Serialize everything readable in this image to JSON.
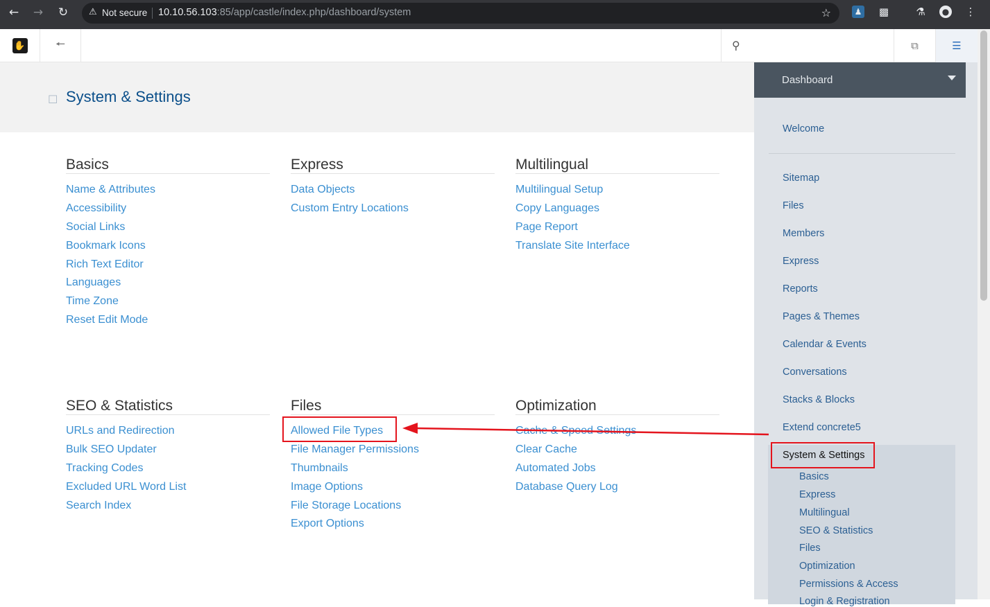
{
  "browser": {
    "security_label": "Not secure",
    "url_host": "10.10.56.103",
    "url_rest": ":85/app/castle/index.php/dashboard/system"
  },
  "toolbar": {
    "search_placeholder": ""
  },
  "page": {
    "title": "System & Settings"
  },
  "sections": [
    {
      "title": "Basics",
      "links": [
        "Name & Attributes",
        "Accessibility",
        "Social Links",
        "Bookmark Icons",
        "Rich Text Editor",
        "Languages",
        "Time Zone",
        "Reset Edit Mode"
      ]
    },
    {
      "title": "Express",
      "links": [
        "Data Objects",
        "Custom Entry Locations"
      ]
    },
    {
      "title": "Multilingual",
      "links": [
        "Multilingual Setup",
        "Copy Languages",
        "Page Report",
        "Translate Site Interface"
      ]
    },
    {
      "title": "SEO & Statistics",
      "links": [
        "URLs and Redirection",
        "Bulk SEO Updater",
        "Tracking Codes",
        "Excluded URL Word List",
        "Search Index"
      ]
    },
    {
      "title": "Files",
      "links": [
        "Allowed File Types",
        "File Manager Permissions",
        "Thumbnails",
        "Image Options",
        "File Storage Locations",
        "Export Options"
      ]
    },
    {
      "title": "Optimization",
      "links": [
        "Cache & Speed Settings",
        "Clear Cache",
        "Automated Jobs",
        "Database Query Log"
      ]
    }
  ],
  "panel": {
    "title": "Dashboard",
    "welcome": "Welcome",
    "items": [
      "Sitemap",
      "Files",
      "Members",
      "Express",
      "Reports",
      "Pages & Themes",
      "Calendar & Events",
      "Conversations",
      "Stacks & Blocks",
      "Extend concrete5",
      "System & Settings"
    ],
    "subitems": [
      "Basics",
      "Express",
      "Multilingual",
      "SEO & Statistics",
      "Files",
      "Optimization",
      "Permissions & Access",
      "Login & Registration"
    ]
  },
  "colors": {
    "link": "#3a8fd1",
    "title": "#0b4f8a",
    "highlight": "#e4141d",
    "panel_bg": "#dfe3e8",
    "panel_head": "#4a5560"
  },
  "icons": [
    "back-icon",
    "forward-icon",
    "reload-icon",
    "warning-icon",
    "star-icon",
    "extension-icon",
    "labs-icon",
    "profile-icon",
    "menu-icon",
    "concrete5-logo-icon",
    "arrow-left-icon",
    "search-icon",
    "pages-icon",
    "sliders-icon",
    "bookmark-icon",
    "caret-down-icon"
  ]
}
